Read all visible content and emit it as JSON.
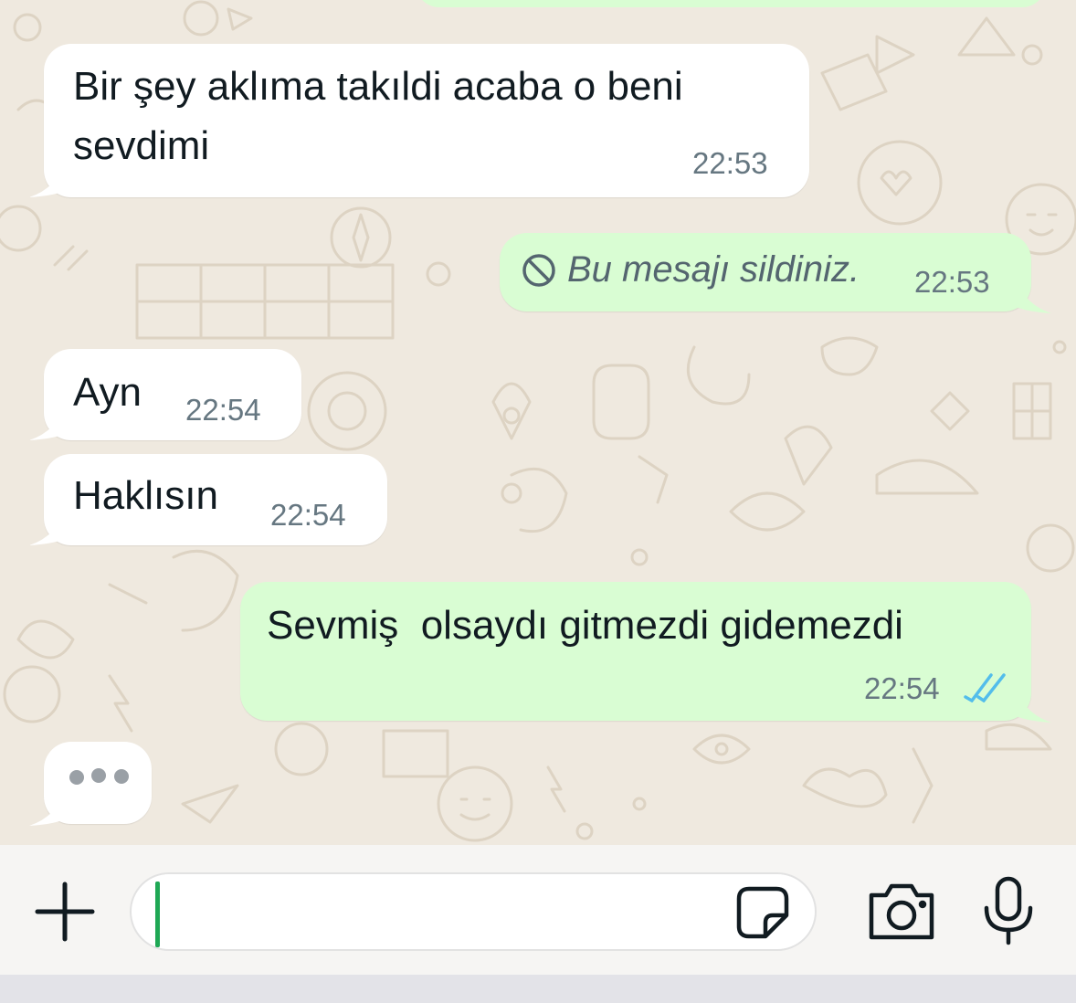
{
  "theme": {
    "incoming_bubble": "#ffffff",
    "outgoing_bubble": "#d9fdd3",
    "wallpaper": "#efe9df",
    "read_ticks": "#53bdeb",
    "caret": "#1fa855"
  },
  "messages": [
    {
      "direction": "incoming",
      "text_line1": "Bir şey aklıma takıldi acaba o beni",
      "text_line2": "sevdimi",
      "time": "22:53"
    },
    {
      "direction": "outgoing",
      "deleted": true,
      "text": "Bu mesajı sildiniz.",
      "time": "22:53",
      "icon": "prohibited-icon"
    },
    {
      "direction": "incoming",
      "text": "Ayn",
      "time": "22:54"
    },
    {
      "direction": "incoming",
      "text": "Haklısın",
      "time": "22:54"
    },
    {
      "direction": "outgoing",
      "text": "Sevmiş  olsaydı gitmezdi gidemezdi",
      "time": "22:54",
      "status": "read",
      "status_icon": "double-check-icon"
    }
  ],
  "typing_indicator": {
    "visible": true
  },
  "composer": {
    "value": "",
    "attach_icon": "plus-icon",
    "sticker_icon": "sticker-icon",
    "camera_icon": "camera-icon",
    "mic_icon": "microphone-icon"
  }
}
